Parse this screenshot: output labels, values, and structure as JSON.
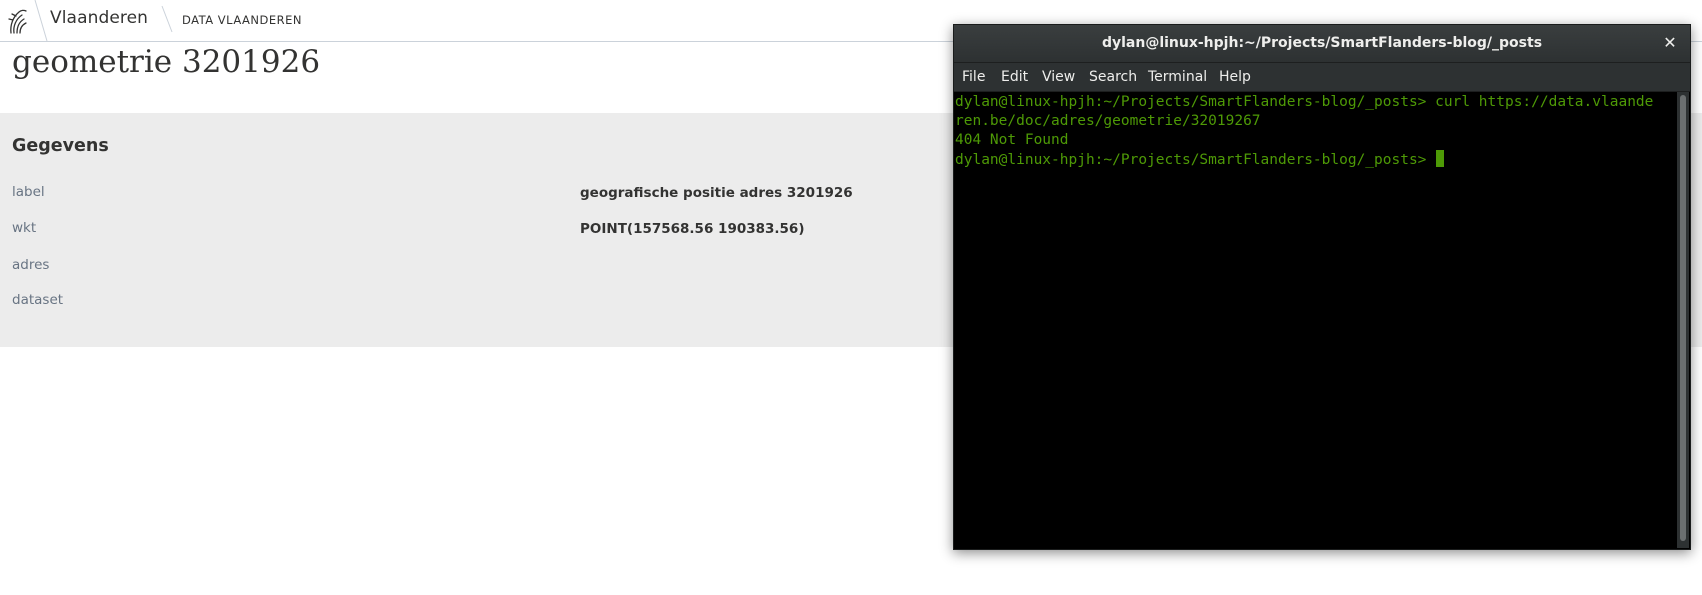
{
  "site": {
    "brand": "Vlaanderen",
    "section": "DATA VLAANDEREN",
    "icon": "flemish-lion-icon"
  },
  "page": {
    "title": "geometrie 3201926",
    "panel_heading": "Gegevens",
    "rows": [
      {
        "label": "label",
        "value": "geografische positie adres 3201926"
      },
      {
        "label": "wkt",
        "value": "POINT(157568.56 190383.56)"
      },
      {
        "label": "adres",
        "value": ""
      },
      {
        "label": "dataset",
        "value": ""
      }
    ]
  },
  "terminal": {
    "title": "dylan@linux-hpjh:~/Projects/SmartFlanders-blog/_posts",
    "close_icon": "close-icon",
    "menu": [
      "File",
      "Edit",
      "View",
      "Search",
      "Terminal",
      "Help"
    ],
    "lines": [
      "dylan@linux-hpjh:~/Projects/SmartFlanders-blog/_posts> curl https://data.vlaande",
      "ren.be/doc/adres/geometrie/32019267",
      "404 Not Found",
      "dylan@linux-hpjh:~/Projects/SmartFlanders-blog/_posts> "
    ],
    "text_color": "#4e9a06",
    "background": "#000000"
  }
}
